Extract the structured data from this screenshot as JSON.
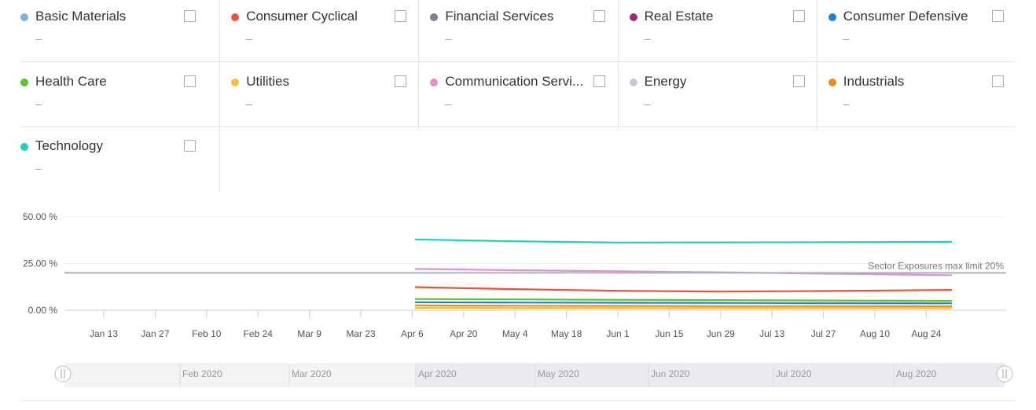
{
  "legend": {
    "items": [
      {
        "name": "Basic Materials",
        "color": "#7eaee8",
        "value": "–"
      },
      {
        "name": "Consumer Cyclical",
        "color": "#e8533a",
        "value": "–"
      },
      {
        "name": "Financial Services",
        "color": "#7a8290",
        "value": "–"
      },
      {
        "name": "Real Estate",
        "color": "#9b2a7c",
        "value": "–"
      },
      {
        "name": "Consumer Defensive",
        "color": "#1b82d6",
        "value": "–"
      },
      {
        "name": "Health Care",
        "color": "#5cc32e",
        "value": "–"
      },
      {
        "name": "Utilities",
        "color": "#f5c231",
        "value": "–"
      },
      {
        "name": "Communication Servi...",
        "color": "#e48fce",
        "value": "–"
      },
      {
        "name": "Energy",
        "color": "#c5cbd3",
        "value": "–"
      },
      {
        "name": "Industrials",
        "color": "#ef8d12",
        "value": "–"
      },
      {
        "name": "Technology",
        "color": "#1fcfc1",
        "value": "–"
      }
    ]
  },
  "chart_data": {
    "type": "line",
    "x_ticks": [
      "Jan 13",
      "Jan 27",
      "Feb 10",
      "Feb 24",
      "Mar 9",
      "Mar 23",
      "Apr 6",
      "Apr 20",
      "May 4",
      "May 18",
      "Jun 1",
      "Jun 15",
      "Jun 29",
      "Jul 13",
      "Jul 27",
      "Aug 10",
      "Aug 24"
    ],
    "y_ticks": [
      "50.00 %",
      "25.00 %",
      "0.00 %"
    ],
    "y_tick_values": [
      50,
      25,
      0
    ],
    "ylim": [
      0,
      50
    ],
    "x_dates": [
      "2020-04-01",
      "2020-04-20",
      "2020-05-04",
      "2020-06-01",
      "2020-06-29",
      "2020-07-27",
      "2020-08-31"
    ],
    "series": [
      {
        "name": "Technology",
        "color": "#1fcfc1",
        "values": [
          37.9,
          37.4,
          36.9,
          36.2,
          36.3,
          36.4,
          36.6
        ]
      },
      {
        "name": "Communication Servi...",
        "color": "#e48fce",
        "values": [
          22.1,
          21.8,
          21.4,
          20.9,
          20.3,
          19.6,
          18.8
        ]
      },
      {
        "name": "Consumer Cyclical",
        "color": "#e8533a",
        "values": [
          12.4,
          11.8,
          11.3,
          10.4,
          10.0,
          10.3,
          10.9
        ]
      },
      {
        "name": "Health Care",
        "color": "#5cc32e",
        "values": [
          6.0,
          5.9,
          5.8,
          5.6,
          5.4,
          5.2,
          5.0
        ]
      },
      {
        "name": "Consumer Defensive",
        "color": "#1b82d6",
        "values": [
          4.3,
          4.2,
          4.1,
          4.0,
          3.9,
          3.8,
          3.7
        ]
      },
      {
        "name": "Industrials",
        "color": "#ef8d12",
        "values": [
          2.6,
          2.5,
          2.4,
          2.3,
          2.2,
          2.2,
          2.1
        ]
      },
      {
        "name": "Utilities",
        "color": "#f5c231",
        "values": [
          1.3,
          1.3,
          1.2,
          1.2,
          1.1,
          1.1,
          1.1
        ]
      }
    ],
    "limit_line": {
      "label": "Sector Exposures max limit 20%",
      "value": 20,
      "color": "#aab4c0"
    },
    "navigator_labels": [
      "Feb 2020",
      "Mar 2020",
      "Apr 2020",
      "May 2020",
      "Jun 2020",
      "Jul 2020",
      "Aug 2020"
    ]
  }
}
